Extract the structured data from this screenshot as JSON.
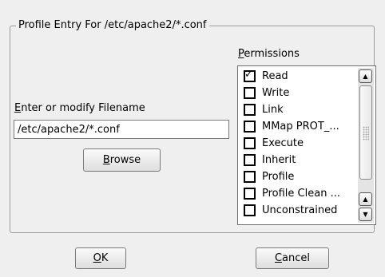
{
  "group": {
    "title": "Profile Entry For /etc/apache2/*.conf"
  },
  "permissions": {
    "label_mnemonic": "P",
    "label_rest": "ermissions",
    "items": [
      {
        "label": "Read",
        "checked": true
      },
      {
        "label": "Write",
        "checked": false
      },
      {
        "label": "Link",
        "checked": false
      },
      {
        "label": "MMap PROT_...",
        "checked": false
      },
      {
        "label": "Execute",
        "checked": false
      },
      {
        "label": "Inherit",
        "checked": false
      },
      {
        "label": "Profile",
        "checked": false
      },
      {
        "label": "Profile Clean ...",
        "checked": false
      },
      {
        "label": "Unconstrained",
        "checked": false
      }
    ]
  },
  "filename": {
    "label_mnemonic": "E",
    "label_rest": "nter or modify Filename",
    "value": "/etc/apache2/*.conf"
  },
  "browse": {
    "mnemonic": "B",
    "rest": "rowse"
  },
  "ok": {
    "mnemonic": "O",
    "rest": "K"
  },
  "cancel": {
    "mnemonic": "C",
    "rest": "ancel"
  }
}
